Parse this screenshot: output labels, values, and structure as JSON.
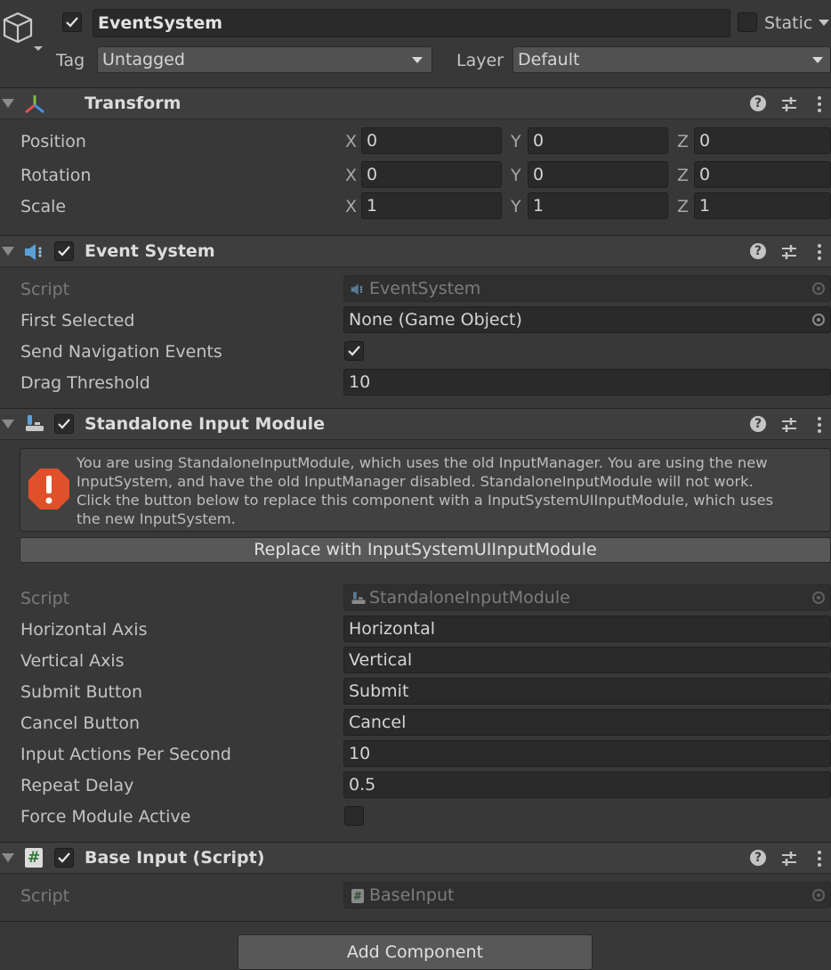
{
  "object": {
    "name": "EventSystem",
    "active": true,
    "static_label": "Static",
    "tag_label": "Tag",
    "tag_value": "Untagged",
    "layer_label": "Layer",
    "layer_value": "Default"
  },
  "transform": {
    "title": "Transform",
    "rows": [
      {
        "label": "Position",
        "x": "0",
        "y": "0",
        "z": "0"
      },
      {
        "label": "Rotation",
        "x": "0",
        "y": "0",
        "z": "0"
      },
      {
        "label": "Scale",
        "x": "1",
        "y": "1",
        "z": "1"
      }
    ],
    "axis_x": "X",
    "axis_y": "Y",
    "axis_z": "Z"
  },
  "event_system": {
    "title": "Event System",
    "enabled": true,
    "script_label": "Script",
    "script_value": "EventSystem",
    "first_selected_label": "First Selected",
    "first_selected_value": "None (Game Object)",
    "send_nav_label": "Send Navigation Events",
    "send_nav_checked": true,
    "drag_threshold_label": "Drag Threshold",
    "drag_threshold_value": "10"
  },
  "standalone": {
    "title": "Standalone Input Module",
    "enabled": true,
    "warning_lines": [
      "You are using StandaloneInputModule, which uses the old InputManager. You are using the new",
      "InputSystem, and have the old InputManager disabled. StandaloneInputModule will not work.",
      "Click the button below to replace this component with a InputSystemUIInputModule, which uses",
      "the new InputSystem."
    ],
    "replace_button": "Replace with InputSystemUIInputModule",
    "script_label": "Script",
    "script_value": "StandaloneInputModule",
    "horizontal_label": "Horizontal Axis",
    "horizontal_value": "Horizontal",
    "vertical_label": "Vertical Axis",
    "vertical_value": "Vertical",
    "submit_label": "Submit Button",
    "submit_value": "Submit",
    "cancel_label": "Cancel Button",
    "cancel_value": "Cancel",
    "actions_label": "Input Actions Per Second",
    "actions_value": "10",
    "repeat_label": "Repeat Delay",
    "repeat_value": "0.5",
    "force_label": "Force Module Active",
    "force_checked": false
  },
  "base_input": {
    "title": "Base Input (Script)",
    "enabled": true,
    "script_label": "Script",
    "script_value": "BaseInput"
  },
  "add_component_label": "Add Component",
  "colors": {
    "background": "#383838",
    "header": "#3e3e3e",
    "field": "#2a2a2a",
    "warning_icon": "#e0502b"
  }
}
